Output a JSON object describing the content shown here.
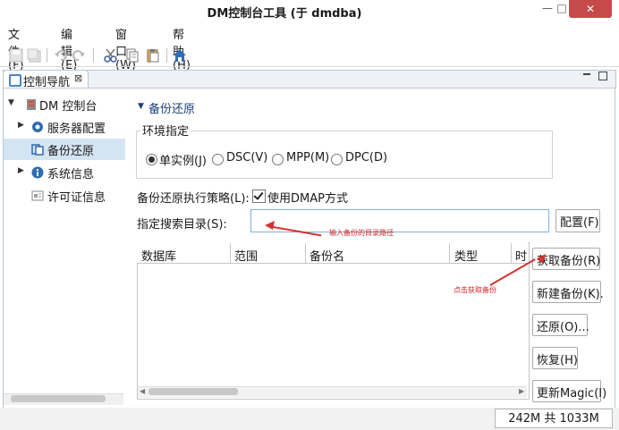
{
  "window": {
    "title": "DM控制台工具 (于 dmdba)",
    "minimize_glyph": "—",
    "maximize_glyph": "□",
    "close_glyph": "✕"
  },
  "menubar": {
    "items": [
      "文件(F)",
      "编辑(E)",
      "窗口(W)",
      "帮助(H)"
    ]
  },
  "toolbar": {
    "icons": [
      "save-icon",
      "save-all-icon",
      "undo-icon",
      "redo-icon",
      "cut-icon",
      "copy-icon",
      "paste-icon",
      "home-icon"
    ]
  },
  "nav": {
    "tab_label": "控制导航",
    "close_glyph": "⊠",
    "tree": {
      "root": "DM 控制台",
      "items": [
        "服务器配置",
        "备份还原",
        "系统信息",
        "许可证信息"
      ],
      "selected": "备份还原"
    }
  },
  "main": {
    "section_title": "备份还原",
    "env": {
      "legend": "环境指定",
      "options": [
        "单实例(J)",
        "DSC(V)",
        "MPP(M)",
        "DPC(D)"
      ],
      "selected": "单实例(J)"
    },
    "strategy": {
      "label": "备份还原执行策略(L):",
      "checkbox_label": "使用DMAP方式",
      "checked": true
    },
    "search_dir": {
      "label": "指定搜索目录(S):",
      "value": "",
      "config_button": "配置(F)"
    },
    "table": {
      "columns": [
        "数据库",
        "范围",
        "备份名",
        "类型",
        "时"
      ],
      "rows": []
    },
    "buttons": {
      "get_backup": "获取备份(R)",
      "new_backup": "新建备份(K).",
      "restore": "还原(O)...",
      "recover": "恢复(H)",
      "update_magic": "更新Magic(I)"
    },
    "annotations": {
      "input_hint": "输入备份的目录路径",
      "click_hint": "点击获取备份"
    }
  },
  "status": {
    "memory": "242M 共 1033M"
  },
  "colors": {
    "accent": "#4a86c5",
    "annotation": "#d62020",
    "close_button": "#c74a4a",
    "selected_row": "#d5e4f3"
  }
}
